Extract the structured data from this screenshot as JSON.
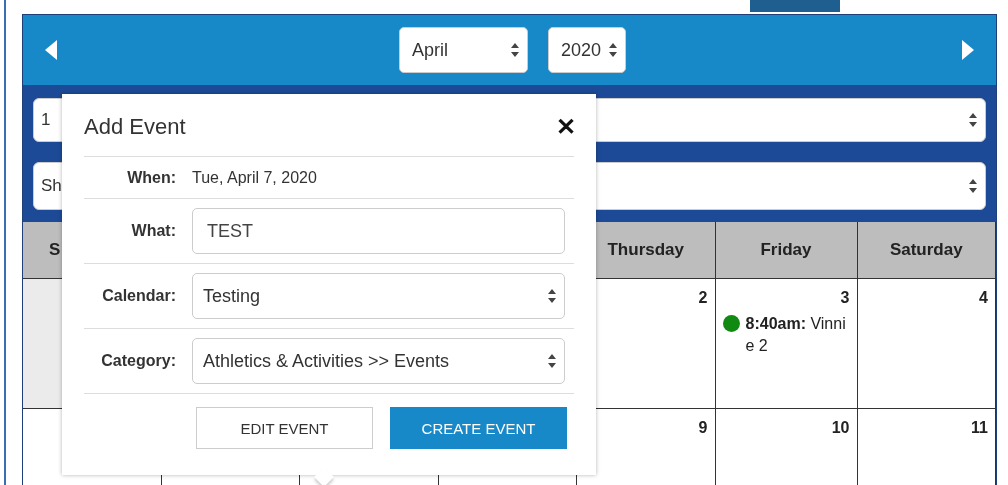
{
  "header": {
    "month_select": {
      "value": "April"
    },
    "year_select": {
      "value": "2020"
    }
  },
  "filters": [
    {
      "value": "1"
    },
    {
      "value": "Sh"
    }
  ],
  "calendar": {
    "weekdays": [
      {
        "label": "S"
      },
      {
        "label": "Thursday"
      },
      {
        "label": "Friday"
      },
      {
        "label": "Saturday"
      }
    ],
    "weeks": [
      {
        "cells": [
          {
            "outside_month": true
          },
          {
            "outside_month": false,
            "day": "2"
          },
          {
            "outside_month": false,
            "day": "3",
            "events": [
              {
                "text": "**8:40am:** Vinnie 2",
                "color": "#118a11"
              }
            ]
          },
          {
            "outside_month": false,
            "day": "4"
          }
        ]
      },
      {
        "cells": [
          {
            "outside_month": false
          },
          {
            "outside_month": false,
            "day": "9"
          },
          {
            "outside_month": false,
            "day": "10"
          },
          {
            "outside_month": false,
            "day": "11"
          }
        ]
      }
    ]
  },
  "popup": {
    "title": "Add Event",
    "close": "✕",
    "fields": [
      {
        "kind": "text",
        "label": "When:",
        "value": "Tue, April 7, 2020"
      },
      {
        "kind": "input",
        "label": "What:",
        "value": "TEST"
      },
      {
        "kind": "select",
        "label": "Calendar:",
        "value": "Testing"
      },
      {
        "kind": "select",
        "label": "Category:",
        "value": "Athletics & Activities >> Events"
      }
    ],
    "buttons": [
      {
        "label": "EDIT EVENT",
        "primary": false
      },
      {
        "label": "CREATE EVENT",
        "primary": true
      }
    ]
  }
}
